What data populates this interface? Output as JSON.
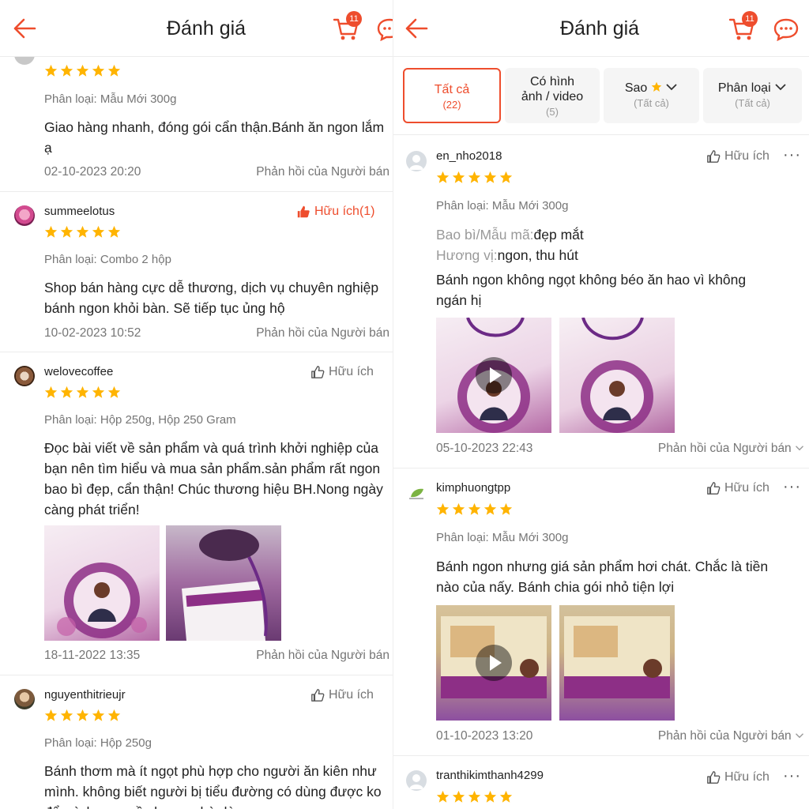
{
  "left": {
    "title": "Đánh giá",
    "cart_count": "11",
    "reviews": [
      {
        "variant": "Phân loại: Mẫu Mới 300g",
        "text": [
          "Giao hàng nhanh, đóng gói cẩn thận.Bánh ăn ngon lắm",
          "ạ"
        ],
        "date": "02-10-2023 20:20",
        "reply": "Phản hồi của Người bán"
      },
      {
        "user": "summeelotus",
        "helpful": "Hữu ích(1)",
        "variant": "Phân loại: Combo 2 hộp",
        "text": [
          "Shop bán hàng cực dễ thương, dịch vụ chuyên nghiệp",
          "bánh ngon khỏi bàn. Sẽ tiếp tục ủng hộ"
        ],
        "date": "10-02-2023 10:52",
        "reply": "Phản hồi của Người bán"
      },
      {
        "user": "welovecoffee",
        "helpful": "Hữu ích",
        "variant": "Phân loại: Hộp 250g, Hộp 250 Gram",
        "text": [
          "Đọc bài viết về sản phẩm và quá trình khởi nghiệp của",
          "bạn nên tìm hiểu và mua sản phẩm.sản phẩm rất ngon",
          "bao bì đẹp, cẩn thận! Chúc thương hiệu BH.Nong ngày",
          "càng phát triển!"
        ],
        "date": "18-11-2022 13:35",
        "reply": "Phản hồi của Người bán",
        "images": [
          "bag-photo",
          "box-photo"
        ]
      },
      {
        "user": "nguyenthitrieujr",
        "helpful": "Hữu ích",
        "variant": "Phân loại: Hộp 250g",
        "text": [
          "Bánh thơm mà ít ngọt phù hợp cho người ăn kiên như",
          "mình. không biết người bị tiểu đường có dùng được ko",
          "để mình mua về cho ng nhà dùng"
        ]
      }
    ]
  },
  "right": {
    "title": "Đánh giá",
    "cart_count": "11",
    "filters": [
      {
        "label": "Tất cả",
        "count": "(22)",
        "active": true
      },
      {
        "label": "Có hình ảnh / video",
        "line1": "Có hình",
        "line2": "ảnh / video",
        "count": "(5)"
      },
      {
        "label": "Sao",
        "count": "(Tất cả)"
      },
      {
        "label": "Phân loại",
        "count": "(Tất cả)"
      }
    ],
    "reviews": [
      {
        "user": "en_nho2018",
        "helpful": "Hữu ích",
        "more": "···",
        "variant": "Phân loại: Mẫu Mới 300g",
        "attrs": [
          {
            "key": "Bao bì/Mẫu mã:",
            "value": "đẹp mắt"
          },
          {
            "key": "Hương vị:",
            "value": "ngon, thu hút"
          }
        ],
        "text": [
          "Bánh ngon không ngọt không béo ăn hao vì không",
          "ngán hị"
        ],
        "date": "05-10-2023 22:43",
        "reply": "Phản hồi của Người bán"
      },
      {
        "user": "kimphuongtpp",
        "helpful": "Hữu ích",
        "more": "···",
        "variant": "Phân loại: Mẫu Mới 300g",
        "text": [
          "Bánh ngon nhưng giá sản phẩm hơi chát. Chắc là tiền",
          "nào của nấy. Bánh chia gói nhỏ tiện lợi"
        ],
        "date": "01-10-2023 13:20",
        "reply": "Phản hồi của Người bán"
      },
      {
        "user": "tranthikimthanh4299",
        "helpful": "Hữu ích",
        "more": "···"
      }
    ]
  },
  "colors": {
    "accent": "#ee4d2d",
    "star": "#ffb400"
  },
  "icons": [
    "back-arrow-icon",
    "cart-icon",
    "chat-icon",
    "thumbs-up-icon",
    "star-icon",
    "play-icon",
    "chevron-down-icon"
  ]
}
